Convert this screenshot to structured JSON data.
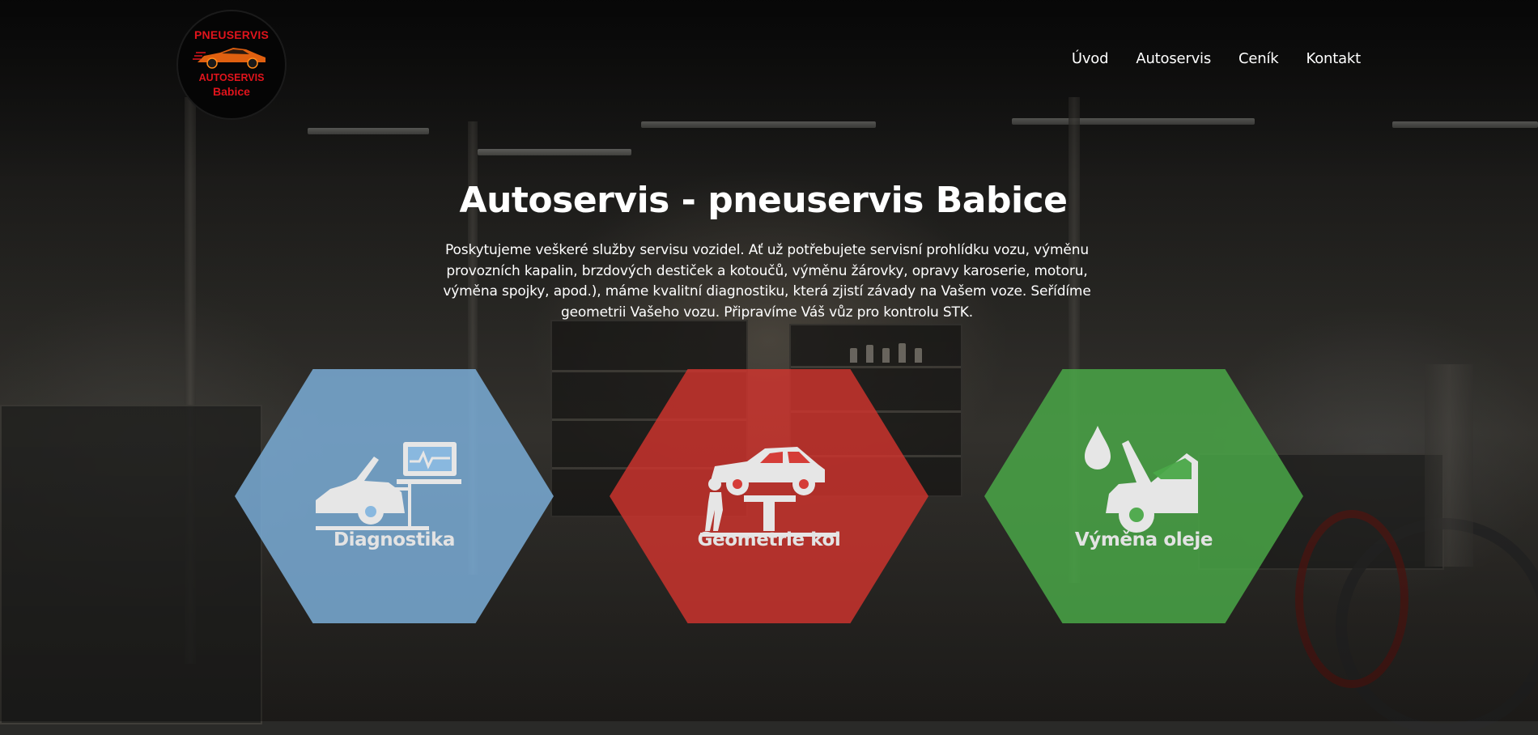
{
  "brand": {
    "logo_top": "PNEUSERVIS",
    "logo_mid": "AUTOSERVIS",
    "logo_bottom": "Babice",
    "logo_color": "#e0141c"
  },
  "nav": {
    "items": [
      {
        "label": "Úvod"
      },
      {
        "label": "Autoservis"
      },
      {
        "label": "Ceník"
      },
      {
        "label": "Kontakt"
      }
    ]
  },
  "hero": {
    "title": "Autoservis - pneuservis Babice",
    "intro": "Poskytujeme veškeré služby servisu vozidel. Ať už potřebujete servisní prohlídku vozu, výměnu provozních kapalin, brzdových destiček a kotoučů, výměnu žárovky, opravy karoserie, motoru, výměna spojky, apod.), máme kvalitní diagnostiku, která zjistí závady na Vašem voze. Seřídíme geometrii Vašeho vozu. Připravíme Váš vůz pro kontrolu STK."
  },
  "services": [
    {
      "label": "Diagnostika",
      "icon": "car-diagnostics-icon",
      "color": "#7eb2de"
    },
    {
      "label": "Geometrie kol",
      "icon": "car-lift-icon",
      "color": "#d4342e"
    },
    {
      "label": "Výměna oleje",
      "icon": "oil-change-icon",
      "color": "#4aa848"
    }
  ]
}
